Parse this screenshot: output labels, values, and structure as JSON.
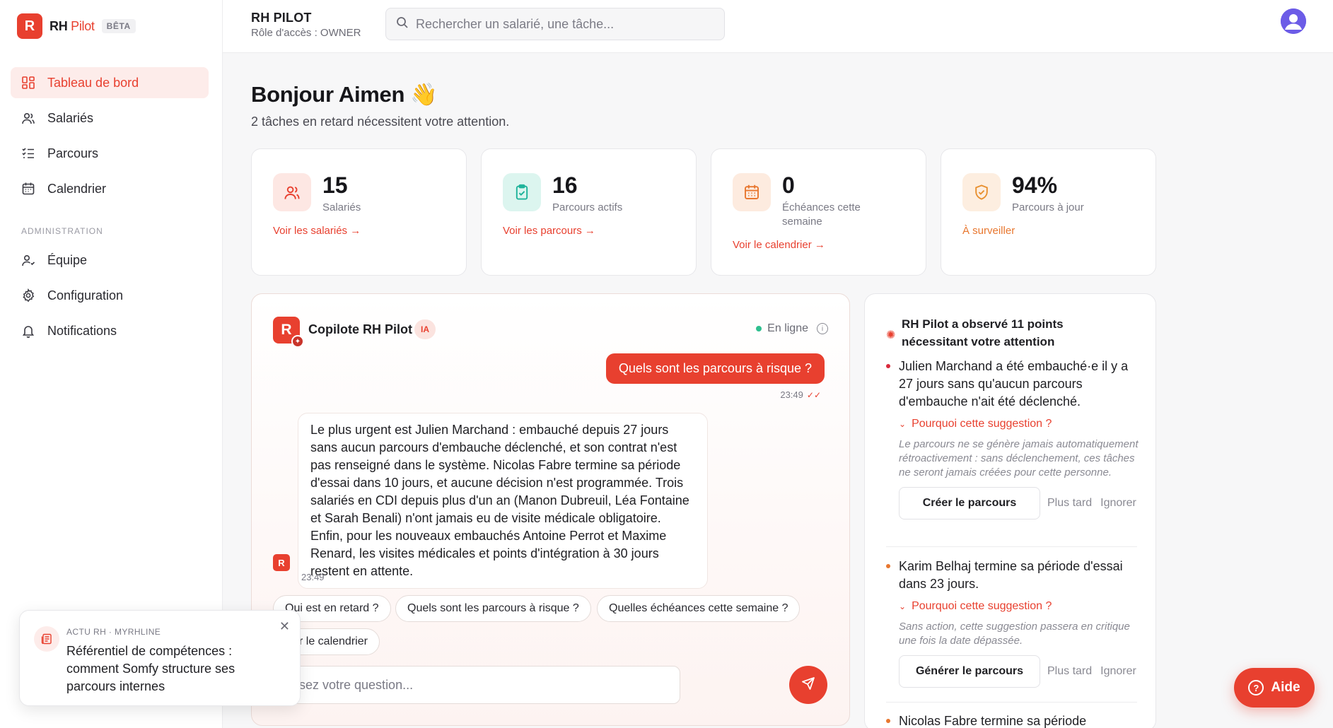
{
  "brand": {
    "logo_letter": "R",
    "name_part1": "RH",
    "name_part2": "Pilot",
    "beta": "BÊTA"
  },
  "sidebar": {
    "items": [
      {
        "label": "Tableau de bord",
        "icon": "dashboard-icon",
        "active": true
      },
      {
        "label": "Salariés",
        "icon": "users-icon"
      },
      {
        "label": "Parcours",
        "icon": "checklist-icon"
      },
      {
        "label": "Calendrier",
        "icon": "calendar-icon"
      }
    ],
    "section": "ADMINISTRATION",
    "admin_items": [
      {
        "label": "Équipe",
        "icon": "team-icon"
      },
      {
        "label": "Configuration",
        "icon": "gear-icon"
      },
      {
        "label": "Notifications",
        "icon": "bell-icon"
      }
    ]
  },
  "topbar": {
    "title": "RH PILOT",
    "role": "Rôle d'accès : OWNER",
    "search_placeholder": "Rechercher un salarié, une tâche..."
  },
  "greeting": {
    "title": "Bonjour Aimen 👋",
    "subtitle": "2 tâches en retard nécessitent votre attention."
  },
  "stats": [
    {
      "value": "15",
      "label": "Salariés",
      "link": "Voir les salariés →",
      "icon": "users-icon",
      "color": "#e8402f"
    },
    {
      "value": "16",
      "label": "Parcours actifs",
      "link": "Voir les parcours →",
      "icon": "clipboard-check-icon",
      "color": "#1eb39a"
    },
    {
      "value": "0",
      "label": "Échéances cette semaine",
      "link": "Voir le calendrier →",
      "icon": "calendar-icon",
      "color": "#e8772f"
    },
    {
      "value": "94%",
      "label": "Parcours à jour",
      "link": "À surveiller",
      "icon": "shield-check-icon",
      "color": "#e8902f"
    }
  ],
  "chat": {
    "logo_letter": "R",
    "title": "Copilote RH Pilot",
    "badge": "IA",
    "status": "En ligne",
    "user_message": "Quels sont les parcours à risque ?",
    "user_time": "23:49",
    "bot_message": "Le plus urgent est Julien Marchand : embauché depuis 27 jours sans aucun parcours d'embauche déclenché, et son contrat n'est pas renseigné dans le système. Nicolas Fabre termine sa période d'essai dans 10 jours, et aucune décision n'est programmée. Trois salariés en CDI depuis plus d'un an (Manon Dubreuil, Léa Fontaine et Sarah Benali) n'ont jamais eu de visite médicale obligatoire. Enfin, pour les nouveaux embauchés Antoine Perrot et Maxime Renard, les visites médicales et points d'intégration à 30 jours restent en attente.",
    "bot_time": "23:49",
    "chips": [
      "Qui est en retard ?",
      "Quels sont les parcours à risque ?",
      "Quelles échéances cette semaine ?",
      "r le calendrier"
    ],
    "input_placeholder": "sez votre question..."
  },
  "suggestions": {
    "header": "RH Pilot a observé 11 points nécessitant votre attention",
    "items": [
      {
        "text": "Julien Marchand a été embauché·e il y a 27 jours sans qu'aucun parcours d'embauche n'ait été déclenché.",
        "why": "Pourquoi cette suggestion ?",
        "note": "Le parcours ne se génère jamais automatiquement rétroactivement : sans déclenchement, ces tâches ne seront jamais créées pour cette personne.",
        "action": "Créer le parcours",
        "later": "Plus tard",
        "ignore": "Ignorer",
        "dot_color": "#d92a3c"
      },
      {
        "text": "Karim Belhaj termine sa période d'essai dans 23 jours.",
        "why": "Pourquoi cette suggestion ?",
        "note": "Sans action, cette suggestion passera en critique une fois la date dépassée.",
        "action": "Générer le parcours",
        "later": "Plus tard",
        "ignore": "Ignorer",
        "dot_color": "#e8772f"
      },
      {
        "text": "Nicolas Fabre termine sa période",
        "dot_color": "#e8772f"
      }
    ]
  },
  "toast": {
    "source": "ACTU RH · MYRHLINE",
    "title": "Référentiel de compétences : comment Somfy structure ses parcours internes"
  },
  "help": {
    "label": "Aide"
  }
}
